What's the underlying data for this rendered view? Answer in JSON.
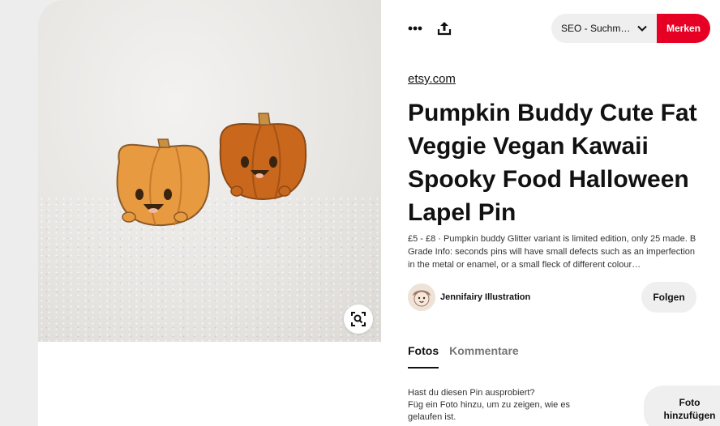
{
  "toolbar": {
    "more_icon": "more-horizontal-icon",
    "share_icon": "share-upload-icon",
    "board_select_value": "SEO - Suchmas...",
    "chevron_icon": "chevron-down-icon",
    "save_label": "Merken",
    "save_color": "#e60023"
  },
  "pin": {
    "source": "etsy.com",
    "title": "Pumpkin Buddy Cute Fat Veggie Vegan Kawaii Spooky Food Halloween Lapel Pin",
    "description": "£5 - £8 · Pumpkin buddy Glitter variant is limited edition, only 25 made. B Grade Info: seconds pins will have small defects such as an imperfection in the metal or enamel, or a small fleck of different colour…",
    "lens_icon": "visual-search-icon"
  },
  "creator": {
    "name": "Jennifairy Illustration",
    "follow_label": "Folgen"
  },
  "tabs": [
    {
      "label": "Fotos",
      "active": true
    },
    {
      "label": "Kommentare",
      "active": false
    }
  ],
  "tried": {
    "text_line1": "Hast du diesen Pin ausprobiert?",
    "text_line2": "Füg ein Foto hinzu, um zu zeigen, wie es gelaufen ist.",
    "button_label": "Foto hinzufügen"
  }
}
